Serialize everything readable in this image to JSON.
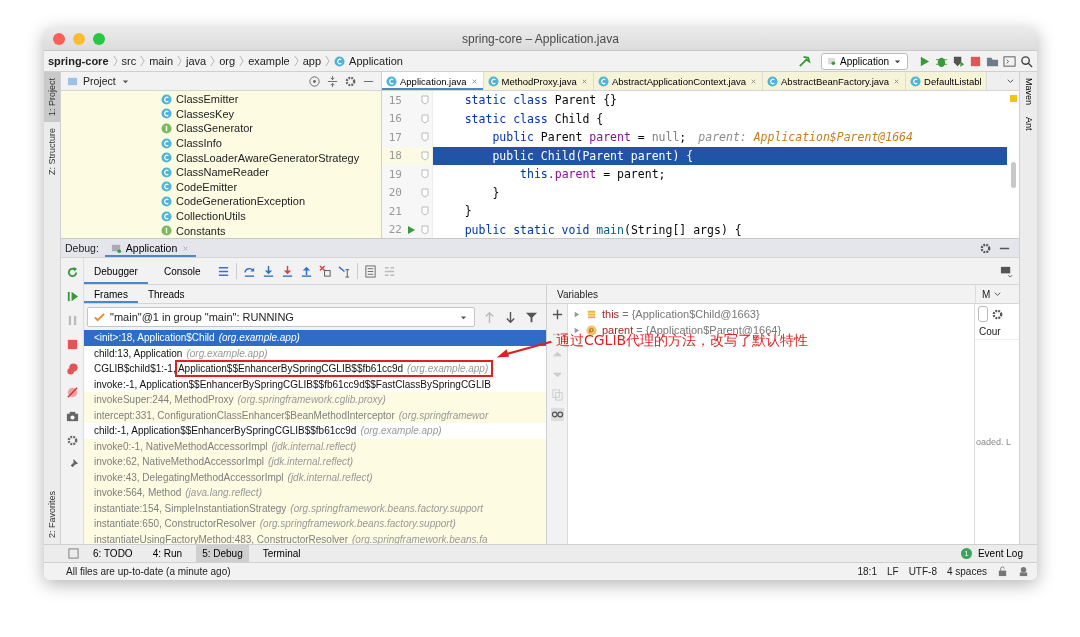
{
  "window": {
    "title": "spring-core – Application.java"
  },
  "breadcrumbs": [
    {
      "label": "spring-core",
      "kind": "project"
    },
    {
      "label": "src",
      "kind": "folder"
    },
    {
      "label": "main",
      "kind": "folder"
    },
    {
      "label": "java",
      "kind": "folder"
    },
    {
      "label": "org",
      "kind": "folder"
    },
    {
      "label": "example",
      "kind": "folder"
    },
    {
      "label": "app",
      "kind": "folder"
    },
    {
      "label": "Application",
      "kind": "class"
    }
  ],
  "run_config": {
    "label": "Application"
  },
  "left_stripe": {
    "top": [
      {
        "label": "1: Project",
        "selected": true
      },
      {
        "label": "Z: Structure",
        "selected": false
      }
    ],
    "bottom": [
      {
        "label": "2: Favorites",
        "selected": false
      }
    ]
  },
  "right_stripe": [
    {
      "label": "Maven"
    },
    {
      "label": "Ant"
    }
  ],
  "project": {
    "title": "Project",
    "items": [
      {
        "label": "ClassEmitter",
        "kind": "class"
      },
      {
        "label": "ClassesKey",
        "kind": "class"
      },
      {
        "label": "ClassGenerator",
        "kind": "interface"
      },
      {
        "label": "ClassInfo",
        "kind": "class"
      },
      {
        "label": "ClassLoaderAwareGeneratorStrategy",
        "kind": "class"
      },
      {
        "label": "ClassNameReader",
        "kind": "class"
      },
      {
        "label": "CodeEmitter",
        "kind": "class"
      },
      {
        "label": "CodeGenerationException",
        "kind": "class"
      },
      {
        "label": "CollectionUtils",
        "kind": "class"
      },
      {
        "label": "Constants",
        "kind": "interface"
      }
    ]
  },
  "editor": {
    "tabs": [
      {
        "label": "Application.java",
        "selected": true,
        "library": false
      },
      {
        "label": "MethodProxy.java",
        "selected": false,
        "library": true
      },
      {
        "label": "AbstractApplicationContext.java",
        "selected": false,
        "library": true
      },
      {
        "label": "AbstractBeanFactory.java",
        "selected": false,
        "library": true
      },
      {
        "label": "DefaultListabl",
        "selected": false,
        "library": true
      }
    ],
    "lines": [
      {
        "number": "15",
        "current": false,
        "run": false,
        "tokens": [
          {
            "kind": "kw",
            "text": "    static class "
          },
          {
            "kind": "plain",
            "text": "Parent {}"
          }
        ]
      },
      {
        "number": "16",
        "current": false,
        "run": false,
        "tokens": [
          {
            "kind": "kw",
            "text": "    static class "
          },
          {
            "kind": "plain",
            "text": "Child {"
          }
        ]
      },
      {
        "number": "17",
        "current": false,
        "run": false,
        "tokens": [
          {
            "kind": "kw",
            "text": "        public "
          },
          {
            "kind": "plain",
            "text": "Parent "
          },
          {
            "kind": "field",
            "text": "parent"
          },
          {
            "kind": "plain",
            "text": " = "
          },
          {
            "kind": "muted",
            "text": "null"
          },
          {
            "kind": "plain",
            "text": ";"
          },
          {
            "kind": "hint-name",
            "text": "parent: "
          },
          {
            "kind": "hint-value",
            "text": "Application$Parent@1664"
          }
        ]
      },
      {
        "number": "18",
        "current": true,
        "run": false,
        "tokens": [
          {
            "kind": "kw",
            "text": "        public "
          },
          {
            "kind": "plain",
            "text": "Child(Parent parent) {"
          }
        ]
      },
      {
        "number": "19",
        "current": false,
        "run": false,
        "tokens": [
          {
            "kind": "kw",
            "text": "            this"
          },
          {
            "kind": "field",
            "text": ".parent"
          },
          {
            "kind": "plain",
            "text": " = parent;"
          }
        ]
      },
      {
        "number": "20",
        "current": false,
        "run": false,
        "tokens": [
          {
            "kind": "plain",
            "text": "        }"
          }
        ]
      },
      {
        "number": "21",
        "current": false,
        "run": false,
        "tokens": [
          {
            "kind": "plain",
            "text": "    }"
          }
        ]
      },
      {
        "number": "22",
        "current": false,
        "run": true,
        "tokens": [
          {
            "kind": "kw",
            "text": "    public static void "
          },
          {
            "kind": "fn",
            "text": "main"
          },
          {
            "kind": "plain",
            "text": "(String[] args) {"
          }
        ]
      }
    ]
  },
  "debug": {
    "title": "Debug:",
    "session": "Application",
    "tabs": [
      {
        "label": "Debugger",
        "selected": true
      },
      {
        "label": "Console",
        "selected": false
      }
    ],
    "frame_tabs": [
      {
        "label": "Frames",
        "selected": true
      },
      {
        "label": "Threads",
        "selected": false
      }
    ],
    "thread": "\"main\"@1 in group \"main\": RUNNING",
    "frames": [
      {
        "method": "<init>:18, Application$Child",
        "package": "(org.example.app)",
        "selected": true,
        "library": false
      },
      {
        "method": "child:13, Application",
        "package": "(org.example.app)",
        "selected": false,
        "library": false
      },
      {
        "method": "CGLIB$child$1:-1, Application$$EnhancerBySpringCGLIB$$fb61cc9d",
        "package": "(org.example.app)",
        "selected": false,
        "library": false
      },
      {
        "method": "invoke:-1, Application$$EnhancerBySpringCGLIB$$fb61cc9d$$FastClassBySpringCGLIB",
        "selected": false,
        "library": false
      },
      {
        "method": "invokeSuper:244, MethodProxy",
        "package": "(org.springframework.cglib.proxy)",
        "selected": false,
        "library": true
      },
      {
        "method": "intercept:331, ConfigurationClassEnhancer$BeanMethodInterceptor",
        "package": "(org.springframewor",
        "selected": false,
        "library": true
      },
      {
        "method": "child:-1, Application$$EnhancerBySpringCGLIB$$fb61cc9d",
        "package": "(org.example.app)",
        "selected": false,
        "library": false
      },
      {
        "method": "invoke0:-1, NativeMethodAccessorImpl",
        "package": "(jdk.internal.reflect)",
        "selected": false,
        "library": true
      },
      {
        "method": "invoke:62, NativeMethodAccessorImpl",
        "package": "(jdk.internal.reflect)",
        "selected": false,
        "library": true
      },
      {
        "method": "invoke:43, DelegatingMethodAccessorImpl",
        "package": "(jdk.internal.reflect)",
        "selected": false,
        "library": true
      },
      {
        "method": "invoke:564, Method",
        "package": "(java.lang.reflect)",
        "selected": false,
        "library": true
      },
      {
        "method": "instantiate:154, SimpleInstantiationStrategy",
        "package": "(org.springframework.beans.factory.support",
        "selected": false,
        "library": true
      },
      {
        "method": "instantiate:650, ConstructorResolver",
        "package": "(org.springframework.beans.factory.support)",
        "selected": false,
        "library": true
      },
      {
        "method": "instantiateUsingFactoryMethod:483, ConstructorResolver",
        "package": "(org.springframework.beans.fa",
        "selected": false,
        "library": true
      }
    ],
    "variables_title": "Variables",
    "variables": [
      {
        "name": "this",
        "value": "= {Application$Child@1663}",
        "kind": "field"
      },
      {
        "name": "parent",
        "value": "= {Application$Parent@1664}",
        "kind": "param"
      }
    ],
    "side_panel": {
      "tab": "M",
      "column": "Cour",
      "note": "oaded. L"
    }
  },
  "annotation": {
    "note": "通过CGLIB代理的方法，改写了默认特性"
  },
  "tool_windows": [
    {
      "label": "6: TODO",
      "selected": false
    },
    {
      "label": "4: Run",
      "selected": false
    },
    {
      "label": "5: Debug",
      "selected": true
    },
    {
      "label": "Terminal",
      "selected": false
    }
  ],
  "event_log": {
    "label": "Event Log",
    "count": "1"
  },
  "status_bar": {
    "message": "All files are up-to-date (a minute ago)",
    "items": [
      "18:1",
      "LF",
      "UTF-8",
      "4 spaces"
    ]
  }
}
